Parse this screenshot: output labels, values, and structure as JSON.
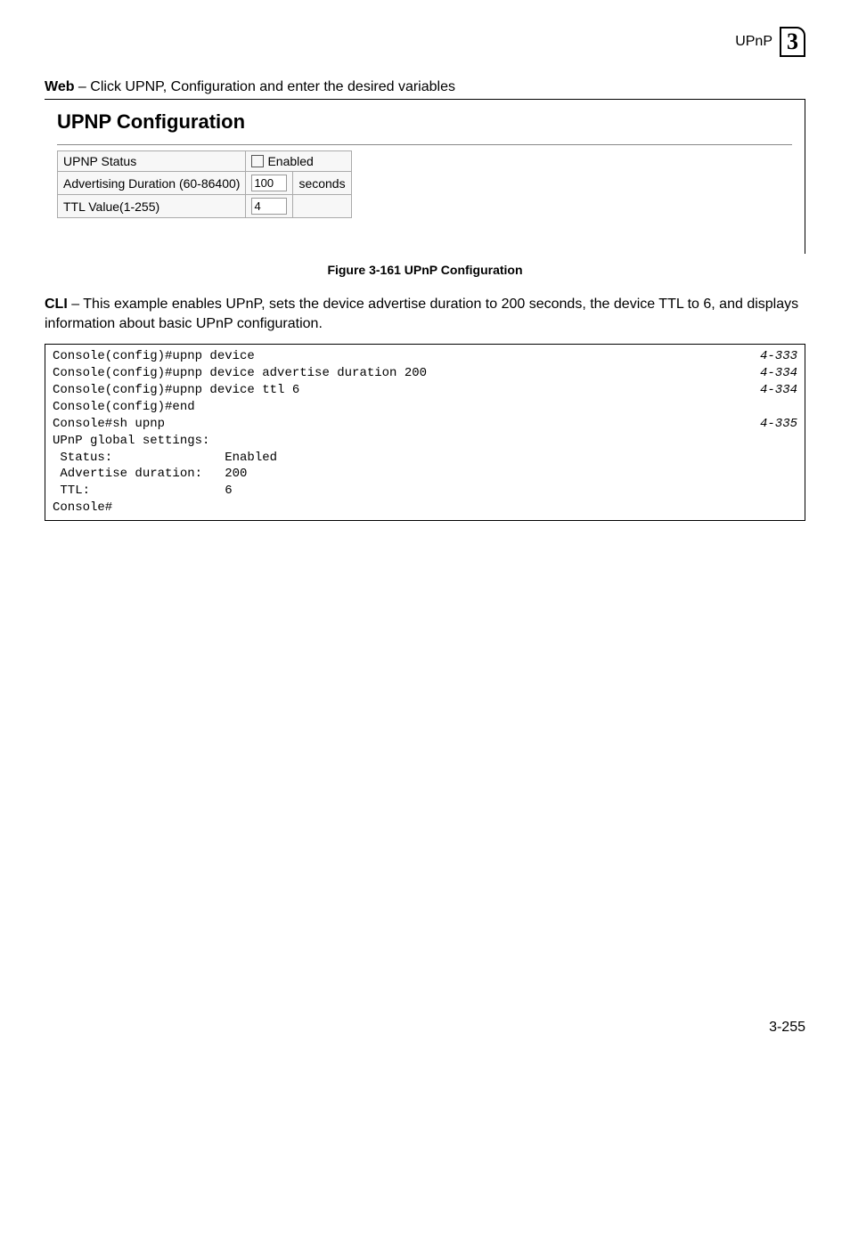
{
  "header": {
    "label": "UPnP",
    "chapter": "3"
  },
  "web_line": {
    "prefix": "Web",
    "rest": " – Click UPNP, Configuration and enter the desired variables"
  },
  "ui": {
    "title": "UPNP Configuration",
    "rows": {
      "status_label": "UPNP Status",
      "enabled_label": "Enabled",
      "adv_label": "Advertising Duration (60-86400)",
      "adv_value": "100",
      "adv_unit": "seconds",
      "ttl_label": "TTL Value(1-255)",
      "ttl_value": "4"
    }
  },
  "figure_caption": "Figure 3-161  UPnP Configuration",
  "cli_intro": {
    "prefix": "CLI",
    "rest": " – This example enables UPnP, sets the device advertise duration to 200 seconds, the device TTL to 6, and displays information about basic UPnP configuration."
  },
  "cli": {
    "l1_left": "Console(config)#upnp device",
    "l1_right": "4-333",
    "l2_left": "Console(config)#upnp device advertise duration 200",
    "l2_right": "4-334",
    "l3_left": "Console(config)#upnp device ttl 6",
    "l3_right": "4-334",
    "l4": "Console(config)#end",
    "l5_left": "Console#sh upnp",
    "l5_right": "4-335",
    "l6": "UPnP global settings:",
    "l7": " Status:               Enabled",
    "l8": " Advertise duration:   200",
    "l9": " TTL:                  6",
    "l10": "Console#"
  },
  "page_number": "3-255"
}
